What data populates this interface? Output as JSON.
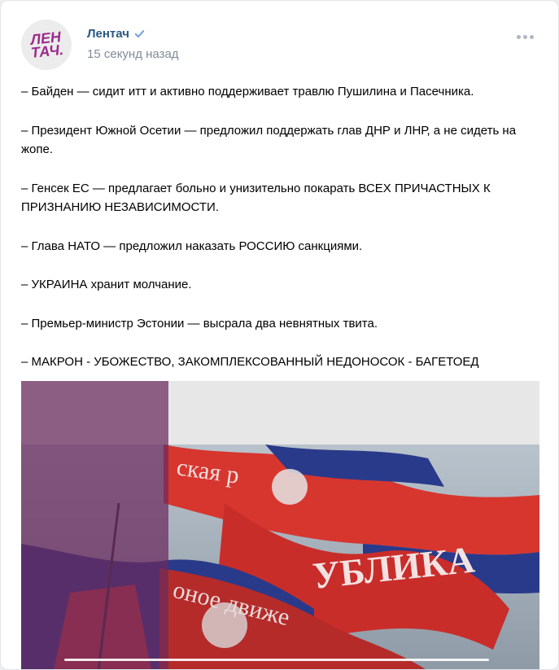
{
  "post": {
    "author": "Лентач",
    "avatar_text_line1": "ЛЕН",
    "avatar_text_line2": "ТАЧ.",
    "timestamp": "15 секунд назад",
    "paragraphs": [
      "– Байден — сидит итт и активно поддерживает травлю Пушилина и Пасечника.",
      "– Президент Южной Осетии — предложил поддержать глав ДНР и ЛНР, а не сидеть на жопе.",
      "– Генсек ЕС — предлагает больно и унизительно покарать ВСЕХ ПРИЧАСТНЫХ К ПРИЗНАНИЮ НЕЗАВИСИМОСТИ.",
      "– Глава НАТО — предложил наказать РОССИЮ санкциями.",
      "– УКРАИНА хранит молчание.",
      "– Премьер-министр Эстонии — высрала два невнятных твита.",
      "– МАКРОН - УБОЖЕСТВО, ЗАКОМПЛЕКСОВАННЫЙ НЕДОНОСОК - БАГЕТОЕД"
    ],
    "media": {
      "flag_text_top": "ская р",
      "flag_text_mid": "УБЛИКА",
      "flag_text_low": "оное движе"
    }
  },
  "colors": {
    "author": "#2a5885",
    "meta": "#818c99",
    "accent_purple": "#6b2a5e",
    "flag_red": "#d7362f",
    "flag_blue": "#2a3a8a"
  },
  "icons": [
    "verified-icon",
    "more-icon"
  ]
}
